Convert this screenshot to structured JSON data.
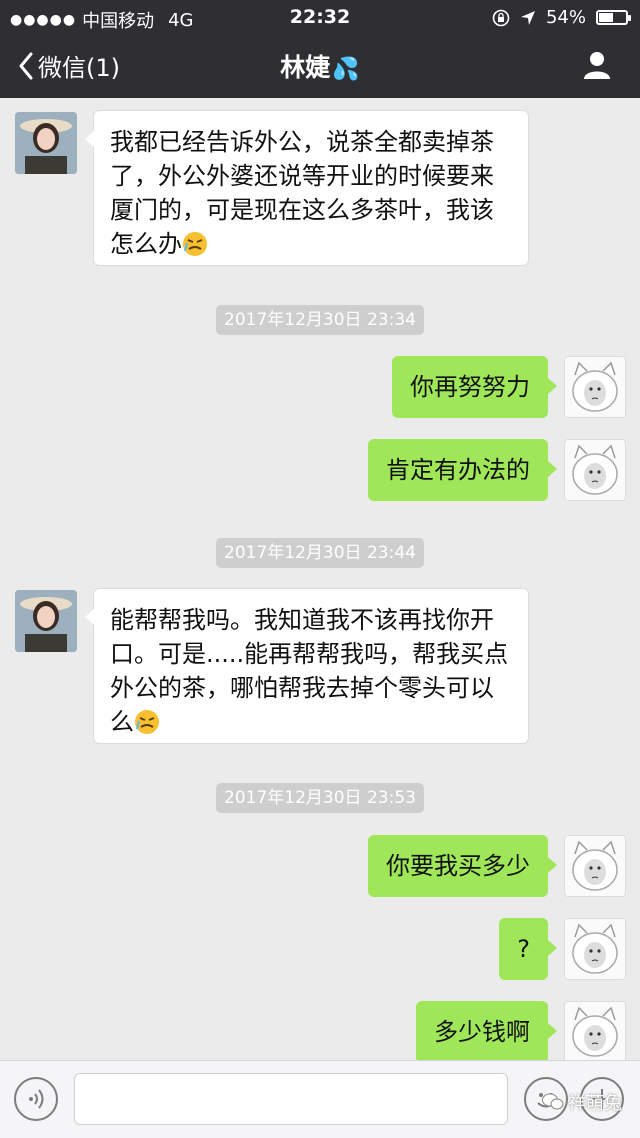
{
  "status": {
    "signal_dots": "●●●●●",
    "carrier": "中国移动",
    "network": "4G",
    "time": "22:32",
    "battery": "54%",
    "battery_level": 0.54
  },
  "nav": {
    "back_label": "微信(1)",
    "title": "林婕"
  },
  "messages": [
    {
      "side": "left",
      "text": "我都已经告诉外公，说茶全都卖掉茶了，外公外婆还说等开业的时候要来厦门的，可是现在这么多茶叶，我该怎么办"
    },
    {
      "time": "2017年12月30日 23:34"
    },
    {
      "side": "right",
      "text": "你再努努力"
    },
    {
      "side": "right",
      "text": "肯定有办法的"
    },
    {
      "time": "2017年12月30日 23:44"
    },
    {
      "side": "left",
      "text": "能帮帮我吗。我知道我不该再找你开口。可是.....能再帮帮我吗，帮我买点外公的茶，哪怕帮我去掉个零头可以么"
    },
    {
      "time": "2017年12月30日 23:53"
    },
    {
      "side": "right",
      "text": "你要我买多少"
    },
    {
      "side": "right",
      "text": "?"
    },
    {
      "side": "right",
      "text": "多少钱啊"
    }
  ],
  "input": {
    "placeholder": ""
  },
  "watermark": "祥萌兔",
  "colors": {
    "nav_bg": "#2f2f33",
    "chat_bg": "#ebebeb",
    "bubble_right": "#9fe658",
    "bubble_left": "#ffffff"
  }
}
